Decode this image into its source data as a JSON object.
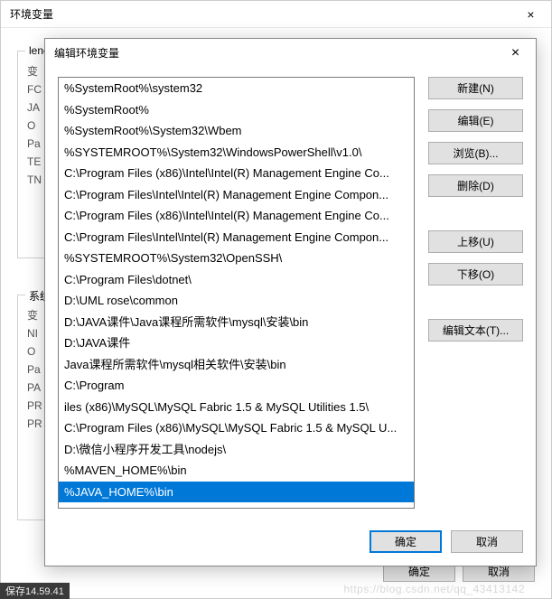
{
  "parent": {
    "title": "环境变量",
    "close_glyph": "×",
    "user_group_label": "leno",
    "sys_group_label": "系统",
    "user_vars": [
      "变",
      "FC",
      "JA",
      "O",
      "Pa",
      "TE",
      "TN"
    ],
    "sys_vars": [
      "变",
      "NI",
      "O",
      "Pa",
      "PA",
      "PR",
      "PR"
    ],
    "ok_label": "确定",
    "cancel_label": "取消"
  },
  "modal": {
    "title": "编辑环境变量",
    "close_glyph": "×",
    "items": [
      "%SystemRoot%\\system32",
      "%SystemRoot%",
      "%SystemRoot%\\System32\\Wbem",
      "%SYSTEMROOT%\\System32\\WindowsPowerShell\\v1.0\\",
      "C:\\Program Files (x86)\\Intel\\Intel(R) Management Engine Co...",
      "C:\\Program Files\\Intel\\Intel(R) Management Engine Compon...",
      "C:\\Program Files (x86)\\Intel\\Intel(R) Management Engine Co...",
      "C:\\Program Files\\Intel\\Intel(R) Management Engine Compon...",
      "%SYSTEMROOT%\\System32\\OpenSSH\\",
      "C:\\Program Files\\dotnet\\",
      "D:\\UML rose\\common",
      "D:\\JAVA课件\\Java课程所需软件\\mysql\\安装\\bin",
      "D:\\JAVA课件",
      "Java课程所需软件\\mysql相关软件\\安装\\bin",
      "C:\\Program",
      "iles (x86)\\MySQL\\MySQL Fabric 1.5 & MySQL Utilities 1.5\\",
      "C:\\Program Files (x86)\\MySQL\\MySQL Fabric 1.5 & MySQL U...",
      "D:\\微信小程序开发工具\\nodejs\\",
      "%MAVEN_HOME%\\bin",
      "%JAVA_HOME%\\bin"
    ],
    "selected_index": 19,
    "buttons": {
      "new": "新建(N)",
      "edit": "编辑(E)",
      "browse": "浏览(B)...",
      "delete": "删除(D)",
      "move_up": "上移(U)",
      "move_down": "下移(O)",
      "edit_text": "编辑文本(T)...",
      "ok": "确定",
      "cancel": "取消"
    }
  },
  "watermark": "https://blog.csdn.net/qq_43413142",
  "tasktime": "保存14.59.41"
}
